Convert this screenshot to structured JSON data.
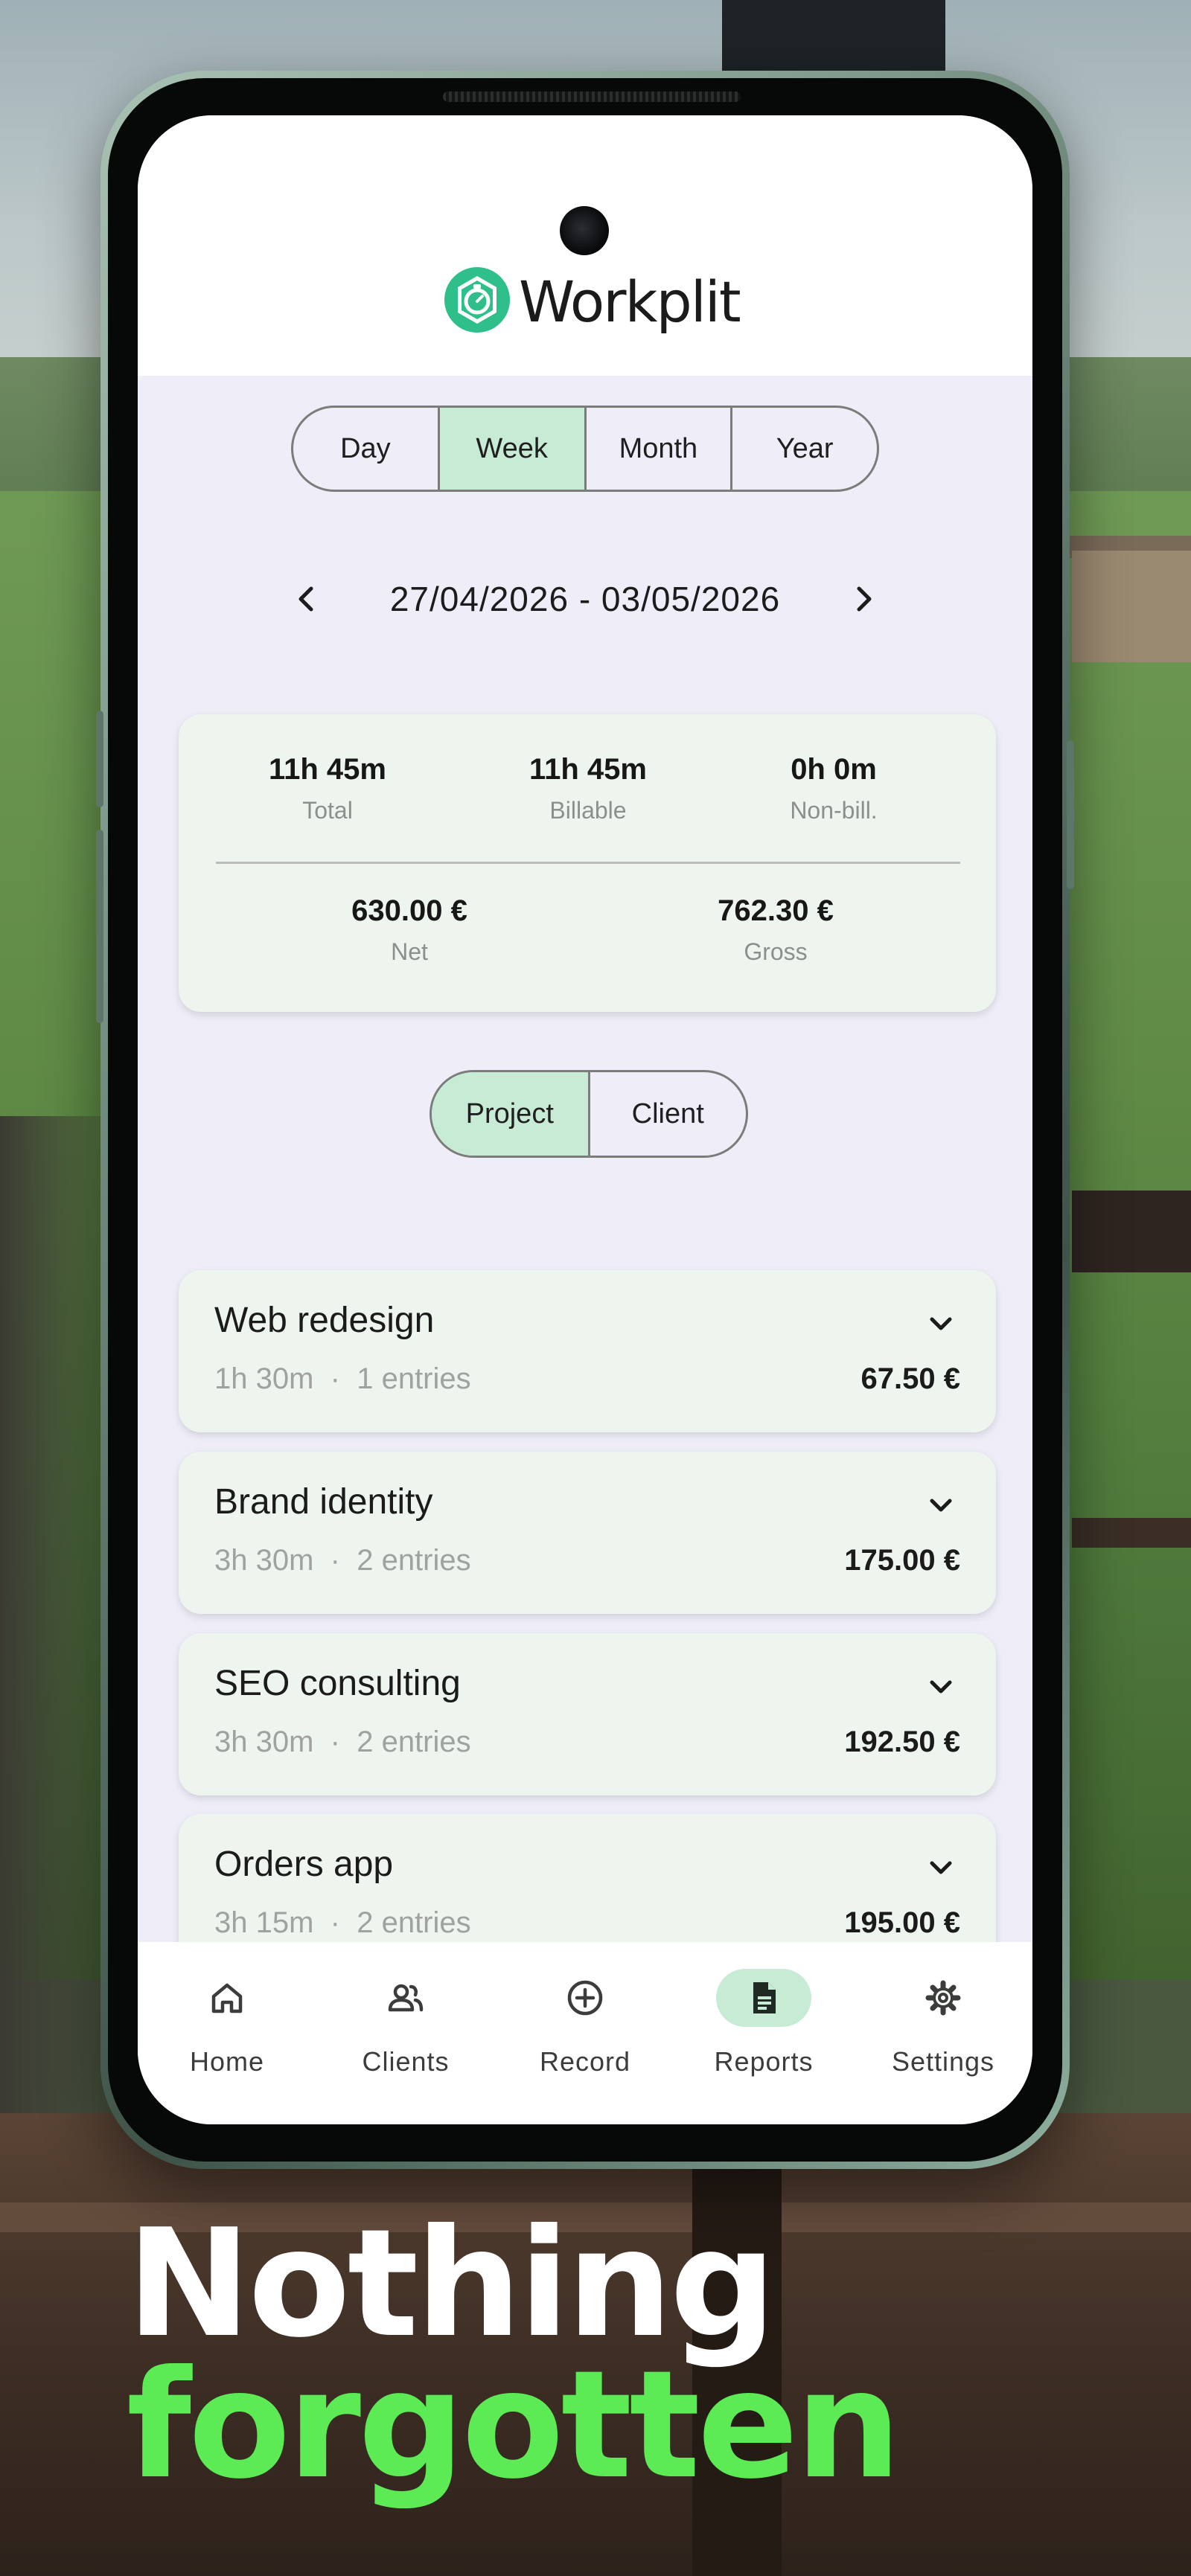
{
  "app": {
    "name": "Workplit"
  },
  "colors": {
    "accent": "#c8ebd6",
    "brand": "#2fbf8a",
    "tagline_highlight": "#5cea55"
  },
  "period_tabs": [
    {
      "label": "Day",
      "active": false
    },
    {
      "label": "Week",
      "active": true
    },
    {
      "label": "Month",
      "active": false
    },
    {
      "label": "Year",
      "active": false
    }
  ],
  "date_range": {
    "text": "27/04/2026 - 03/05/2026"
  },
  "summary": {
    "total": {
      "value": "11h 45m",
      "label": "Total"
    },
    "billable": {
      "value": "11h 45m",
      "label": "Billable"
    },
    "non_billable": {
      "value": "0h 0m",
      "label": "Non-bill."
    },
    "net": {
      "value": "630.00 €",
      "label": "Net"
    },
    "gross": {
      "value": "762.30 €",
      "label": "Gross"
    }
  },
  "group_tabs": [
    {
      "label": "Project",
      "active": true
    },
    {
      "label": "Client",
      "active": false
    }
  ],
  "projects": [
    {
      "name": "Web redesign",
      "duration": "1h 30m",
      "separator": "·",
      "entries": "1 entries",
      "amount": "67.50 €"
    },
    {
      "name": "Brand identity",
      "duration": "3h 30m",
      "separator": "·",
      "entries": "2 entries",
      "amount": "175.00 €"
    },
    {
      "name": "SEO consulting",
      "duration": "3h 30m",
      "separator": "·",
      "entries": "2 entries",
      "amount": "192.50 €"
    },
    {
      "name": "Orders app",
      "duration": "3h 15m",
      "separator": "·",
      "entries": "2 entries",
      "amount": "195.00 €"
    }
  ],
  "bottom_nav": [
    {
      "label": "Home",
      "icon": "home-icon",
      "active": false
    },
    {
      "label": "Clients",
      "icon": "people-icon",
      "active": false
    },
    {
      "label": "Record",
      "icon": "add-circle-icon",
      "active": false
    },
    {
      "label": "Reports",
      "icon": "document-icon",
      "active": true
    },
    {
      "label": "Settings",
      "icon": "gear-icon",
      "active": false
    }
  ],
  "tagline": {
    "line1": "Nothing",
    "line2": "forgotten"
  }
}
